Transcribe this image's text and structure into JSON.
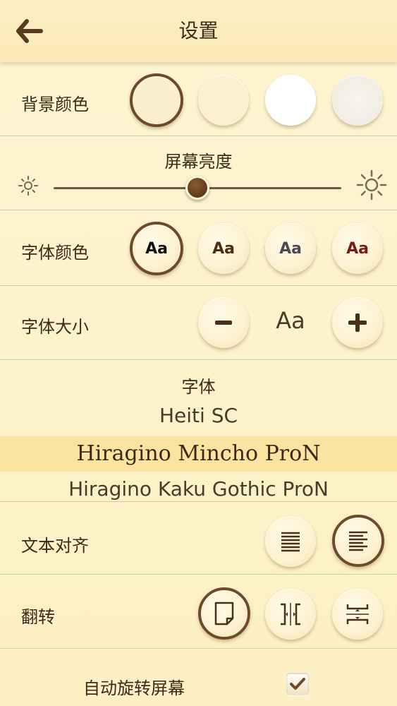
{
  "header": {
    "title": "设置",
    "back_icon": "arrow-left-icon"
  },
  "background_color": {
    "label": "背景颜色",
    "options": [
      "#fcefcd",
      "#fdf0d0",
      "#ffffff",
      "#f7f4ee"
    ],
    "selected_index": 0
  },
  "brightness": {
    "label": "屏幕亮度",
    "value": 0.5
  },
  "font_color": {
    "label": "字体颜色",
    "sample": "Aa",
    "options": [
      "#111111",
      "#4a2e10",
      "#4a4a55",
      "#7a1a10"
    ],
    "selected_index": 0
  },
  "font_size": {
    "label": "字体大小",
    "sample": "Aa"
  },
  "font_picker": {
    "label": "字体",
    "items": [
      {
        "name": "Heiti SC",
        "selected": false
      },
      {
        "name": "Hiragino Mincho ProN",
        "selected": true
      },
      {
        "name": "Hiragino Kaku Gothic ProN",
        "selected": false
      }
    ],
    "highlight_color": "#fbe4a2"
  },
  "text_align": {
    "label": "文本对齐",
    "selected_index": 1
  },
  "page_turn": {
    "label": "翻转",
    "selected_index": 0
  },
  "auto_rotate": {
    "label": "自动旋转屏幕",
    "checked": true
  },
  "accent_color": "#6e4a2c"
}
